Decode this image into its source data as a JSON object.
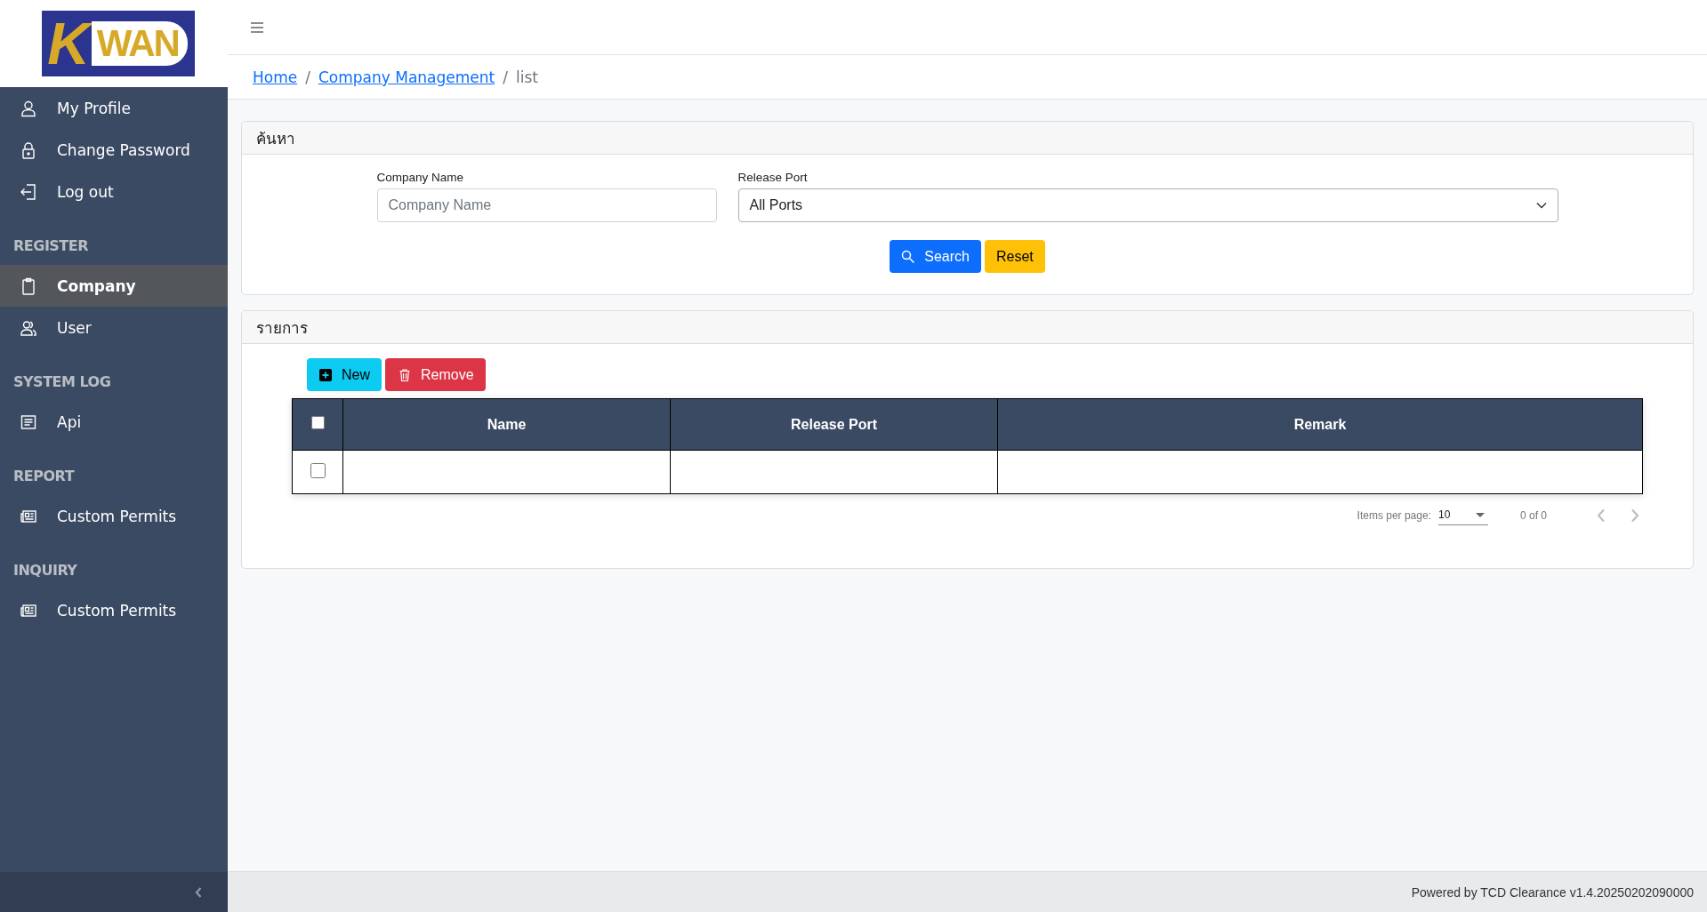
{
  "logo": {
    "initial": "K",
    "rest": "WAN"
  },
  "sidebar": {
    "groups": [
      {
        "items": [
          {
            "label": "My Profile",
            "kind": "person",
            "selected": false
          },
          {
            "label": "Change Password",
            "kind": "lock",
            "selected": false
          },
          {
            "label": "Log out",
            "kind": "logout",
            "selected": false
          }
        ]
      },
      {
        "heading": "REGISTER",
        "items": [
          {
            "label": "Company",
            "kind": "clipboard",
            "selected": true
          },
          {
            "label": "User",
            "kind": "people",
            "selected": false
          }
        ]
      },
      {
        "heading": "SYSTEM LOG",
        "items": [
          {
            "label": "Api",
            "kind": "document",
            "selected": false
          }
        ]
      },
      {
        "heading": "REPORT",
        "items": [
          {
            "label": "Custom Permits",
            "kind": "newspaper",
            "selected": false
          }
        ]
      },
      {
        "heading": "INQUIRY",
        "items": [
          {
            "label": "Custom Permits",
            "kind": "newspaper",
            "selected": false
          }
        ]
      }
    ]
  },
  "breadcrumb": [
    {
      "label": "Home",
      "link": true
    },
    {
      "separator": "/",
      "label": "Company Management",
      "link": true
    },
    {
      "separator": "/",
      "label": "list",
      "link": false
    }
  ],
  "search_card": {
    "title": "ค้นหา",
    "fields": [
      {
        "label": "Company Name",
        "kind": "text",
        "placeholder": "Company Name"
      },
      {
        "label": "Release Port",
        "kind": "select",
        "value": "All Ports"
      }
    ],
    "buttons": [
      {
        "label": "Search",
        "kind": "search"
      },
      {
        "label": "Reset",
        "kind": "reset"
      }
    ]
  },
  "list_card": {
    "title": "รายการ",
    "buttons": [
      {
        "label": "New",
        "kind": "new"
      },
      {
        "label": "Remove",
        "kind": "remove"
      }
    ],
    "table": {
      "header_checked": false,
      "columns": [
        "Name",
        "Release Port",
        "Remark"
      ],
      "rows": [
        {
          "checked": false
        }
      ]
    },
    "pagination": {
      "label": "Items per page:",
      "page_size": "10",
      "range": "0 of 0",
      "prev_disabled": true,
      "next_disabled": true
    }
  },
  "footer": "Powered by TCD Clearance v1.4.20250202090000"
}
